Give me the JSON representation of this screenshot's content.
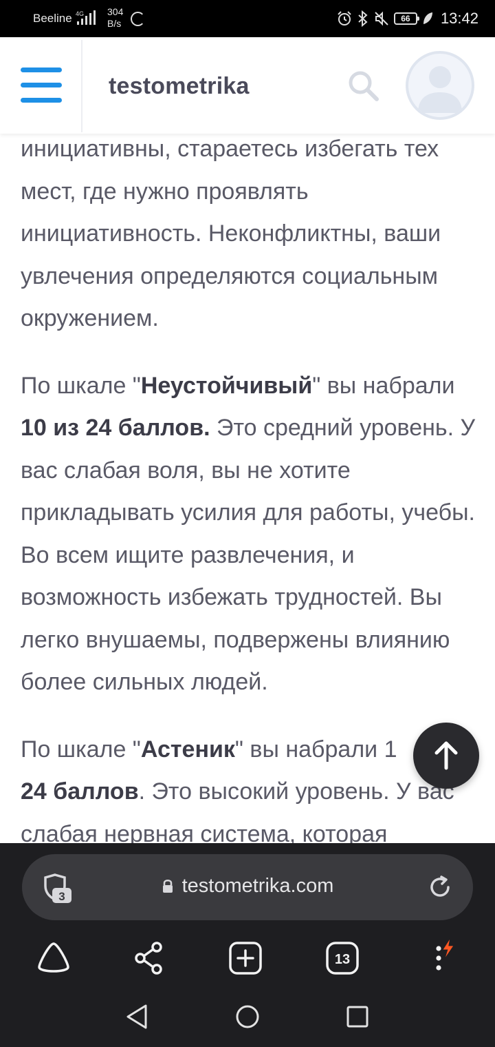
{
  "status_bar": {
    "carrier": "Beeline",
    "network_type": "4G",
    "speed_value": "304",
    "speed_unit": "B/s",
    "battery": "66",
    "time": "13:42",
    "icons": [
      "signal-icon",
      "loading-icon",
      "alarm-icon",
      "bluetooth-icon",
      "mute-icon",
      "battery-icon",
      "leaf-icon"
    ]
  },
  "header": {
    "logo": "testometrika",
    "icons": [
      "menu-icon",
      "search-icon",
      "user-avatar-icon"
    ]
  },
  "article": {
    "p1": "инициативны, стараетесь избегать тех мест, где нужно проявлять инициативность. Неконфликтны, ваши увлечения определяются социальным окружением.",
    "p2_a": "По шкале \"",
    "p2_scale": "Неустойчивый",
    "p2_b": "\" вы набрали ",
    "p2_score": "10 из 24 баллов.",
    "p2_c": " Это средний уровень. У вас слабая воля, вы не хотите прикладывать усилия для работы, учебы. Во всем ищите развлечения, и возможность избежать трудностей. Вы легко внушаемы, подвержены влиянию более сильных людей.",
    "p3_a": "По шкале \"",
    "p3_scale": "Астеник",
    "p3_b": "\" вы набрали 1",
    "p3_score": "24 баллов",
    "p3_c": ". Это высокий уровень. У вас слабая нервная система, которая"
  },
  "browser": {
    "url": "testometrika.com",
    "shield_count": "3",
    "tabs_count": "13",
    "icons": [
      "shield-icon",
      "lock-icon",
      "reload-icon",
      "home-icon",
      "share-icon",
      "new-tab-icon",
      "tabs-icon",
      "more-icon"
    ]
  },
  "colors": {
    "accent": "#1e90e6",
    "body_text": "#595966",
    "browser_bg": "#1e1e21",
    "badge": "#ff5722"
  }
}
